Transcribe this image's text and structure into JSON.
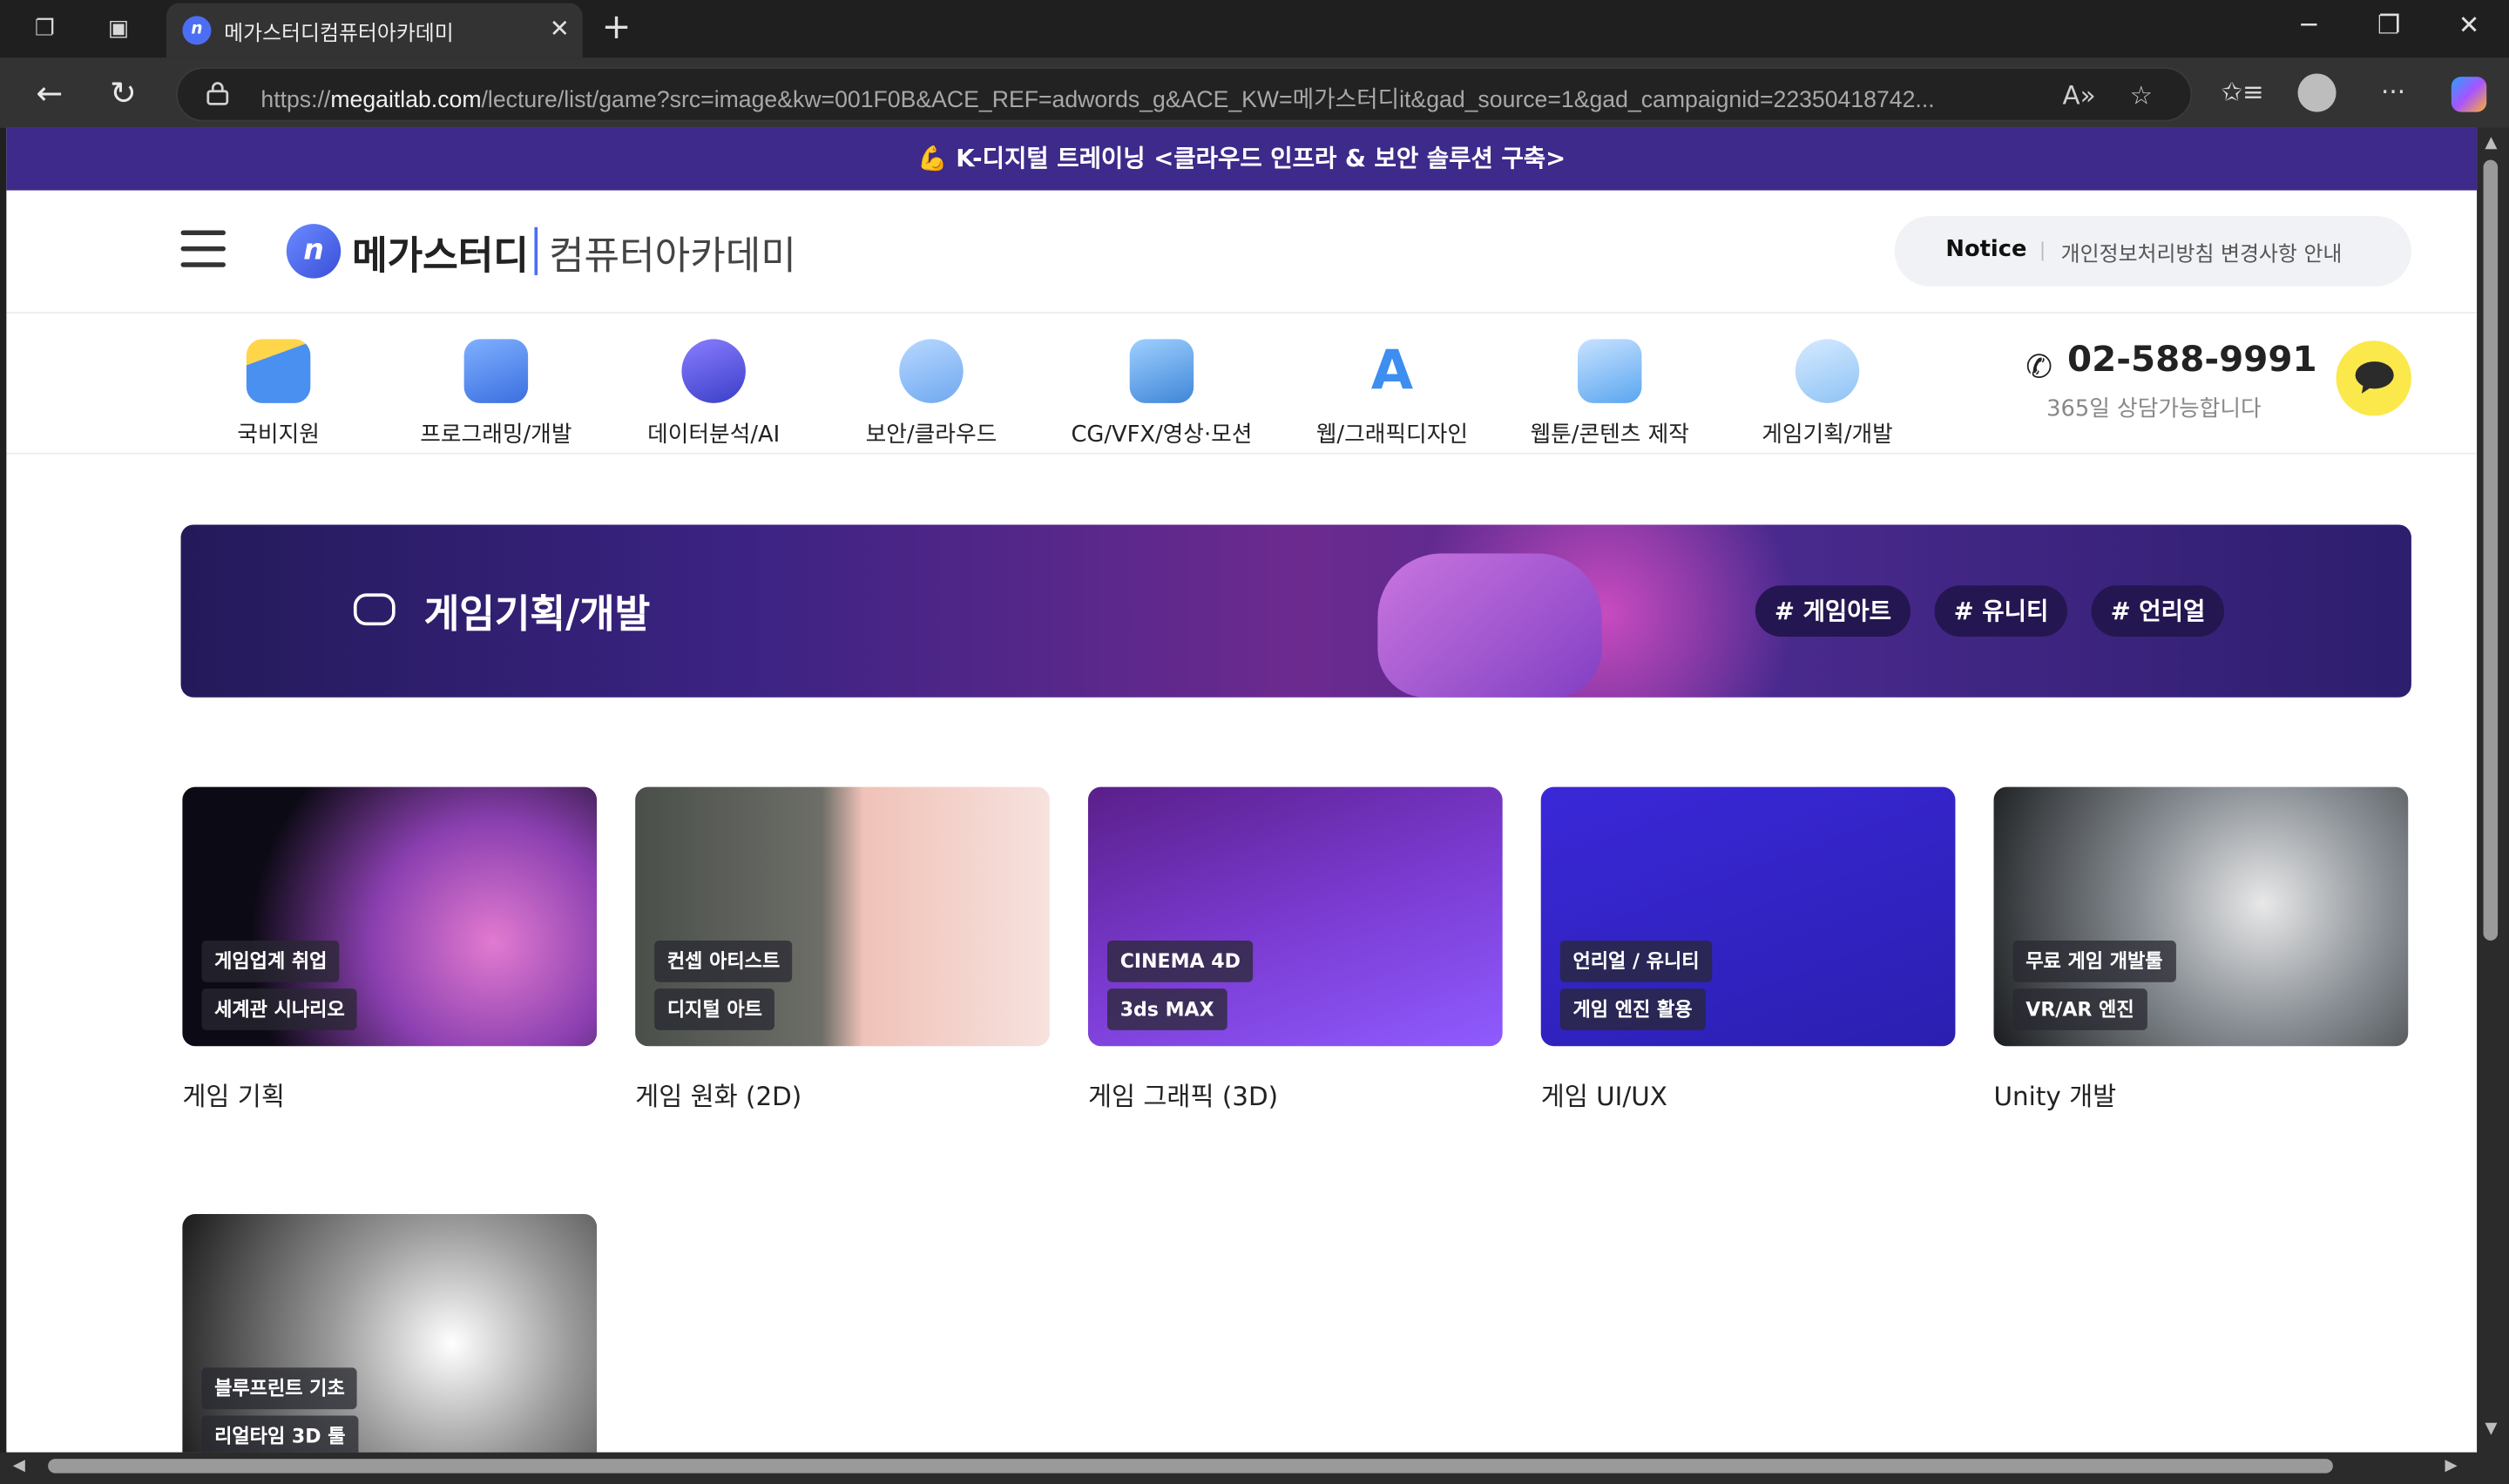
{
  "browser": {
    "tab_title": "메가스터디컴퓨터아카데미",
    "url_domain": "megaitlab.com",
    "url_prefix": "https://",
    "url_rest": "/lecture/list/game?src=image&kw=001F0B&ACE_REF=adwords_g&ACE_KW=메가스터디it&gad_source=1&gad_campaignid=22350418742..."
  },
  "promo": {
    "text": "💪 K-디지털 트레이닝 <클라우드 인프라 & 보안 솔루션 구축>"
  },
  "header": {
    "logo_main": "메가스터디",
    "logo_sub": "컴퓨터아카데미",
    "notice_label": "Notice",
    "notice_text": "개인정보처리방침 변경사항 안내"
  },
  "categories": [
    {
      "label": "국비지원",
      "color": "#4a90f0"
    },
    {
      "label": "프로그래밍/개발",
      "color": "#3b6fe0"
    },
    {
      "label": "데이터분석/AI",
      "color": "#5b5bd6"
    },
    {
      "label": "보안/클라우드",
      "color": "#7db4f5"
    },
    {
      "label": "CG/VFX/영상·모션",
      "color": "#5aa6e8"
    },
    {
      "label": "웹/그래픽디자인",
      "color": "#4aa3f0"
    },
    {
      "label": "웹툰/콘텐츠 제작",
      "color": "#6fb0f2"
    },
    {
      "label": "게임기획/개발",
      "color": "#8ec3f5"
    }
  ],
  "contact": {
    "phone": "02-588-9991",
    "sub": "365일 상담가능합니다"
  },
  "hero": {
    "title": "게임기획/개발",
    "tags": [
      "# 게임아트",
      "# 유니티",
      "# 언리얼"
    ]
  },
  "courses": [
    {
      "name": "게임 기획",
      "chips": [
        "게임업계 취업",
        "세계관 시나리오"
      ]
    },
    {
      "name": "게임 원화 (2D)",
      "chips": [
        "컨셉 아티스트",
        "디지털 아트"
      ]
    },
    {
      "name": "게임 그래픽 (3D)",
      "chips": [
        "CINEMA 4D",
        "3ds MAX"
      ]
    },
    {
      "name": "게임 UI/UX",
      "chips": [
        "언리얼 / 유니티",
        "게임 엔진 활용"
      ]
    },
    {
      "name": "Unity 개발",
      "chips": [
        "무료 게임 개발툴",
        "VR/AR 엔진"
      ]
    },
    {
      "name": "",
      "chips": [
        "블루프린트 기초",
        "리얼타임 3D 툴"
      ]
    }
  ]
}
